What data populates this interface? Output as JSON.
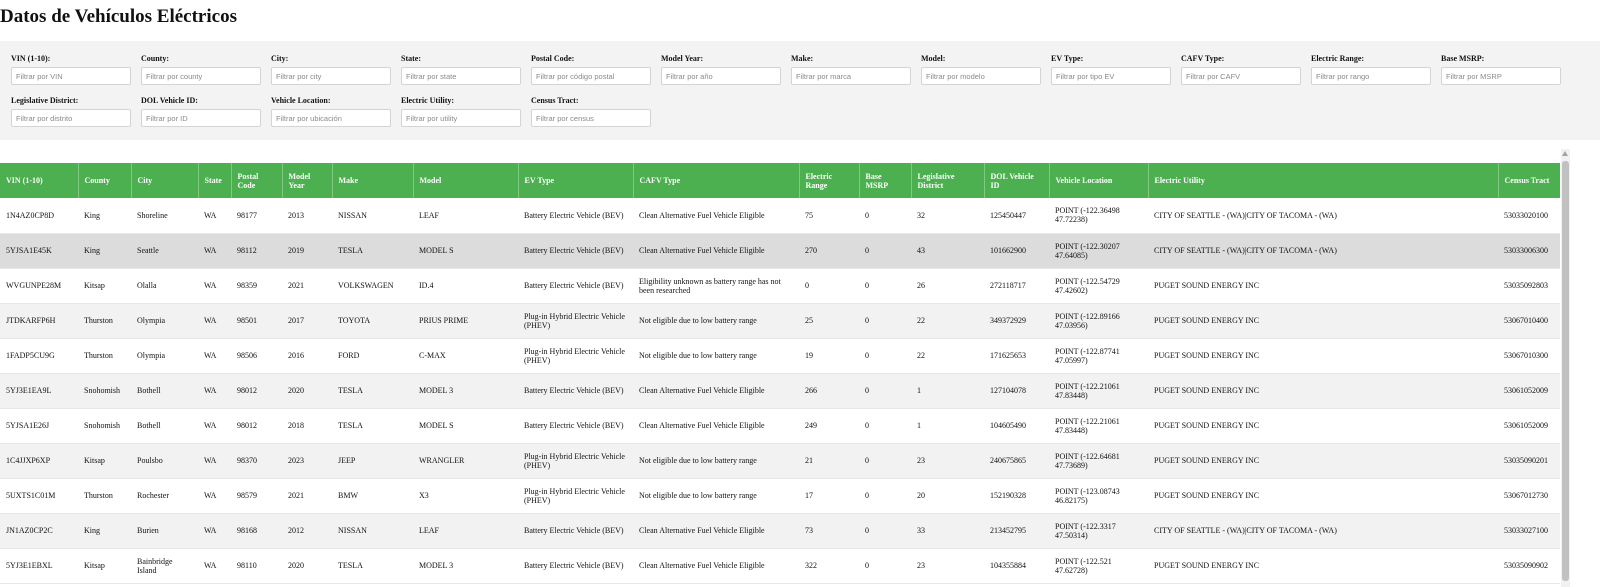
{
  "page": {
    "title": "Datos de Vehículos Eléctricos"
  },
  "filters": [
    {
      "label": "VIN (1-10):",
      "placeholder": "Filtrar por VIN"
    },
    {
      "label": "County:",
      "placeholder": "Filtrar por county"
    },
    {
      "label": "City:",
      "placeholder": "Filtrar por city"
    },
    {
      "label": "State:",
      "placeholder": "Filtrar por state"
    },
    {
      "label": "Postal Code:",
      "placeholder": "Filtrar por código postal"
    },
    {
      "label": "Model Year:",
      "placeholder": "Filtrar por año"
    },
    {
      "label": "Make:",
      "placeholder": "Filtrar por marca"
    },
    {
      "label": "Model:",
      "placeholder": "Filtrar por modelo"
    },
    {
      "label": "EV Type:",
      "placeholder": "Filtrar por tipo EV"
    },
    {
      "label": "CAFV Type:",
      "placeholder": "Filtrar por CAFV"
    },
    {
      "label": "Electric Range:",
      "placeholder": "Filtrar por rango"
    },
    {
      "label": "Base MSRP:",
      "placeholder": "Filtrar por MSRP"
    },
    {
      "label": "Legislative District:",
      "placeholder": "Filtrar por distrito"
    },
    {
      "label": "DOL Vehicle ID:",
      "placeholder": "Filtrar por ID"
    },
    {
      "label": "Vehicle Location:",
      "placeholder": "Filtrar por ubicación"
    },
    {
      "label": "Electric Utility:",
      "placeholder": "Filtrar por utility"
    },
    {
      "label": "Census Tract:",
      "placeholder": "Filtrar por census"
    }
  ],
  "table": {
    "headers": [
      "VIN (1-10)",
      "County",
      "City",
      "State",
      "Postal Code",
      "Model Year",
      "Make",
      "Model",
      "EV Type",
      "CAFV Type",
      "Electric Range",
      "Base MSRP",
      "Legislative District",
      "DOL Vehicle ID",
      "Vehicle Location",
      "Electric Utility",
      "Census Tract"
    ],
    "rows": [
      [
        "1N4AZ0CP8D",
        "King",
        "Shoreline",
        "WA",
        "98177",
        "2013",
        "NISSAN",
        "LEAF",
        "Battery Electric Vehicle (BEV)",
        "Clean Alternative Fuel Vehicle Eligible",
        "75",
        "0",
        "32",
        "125450447",
        "POINT (-122.36498 47.72238)",
        "CITY OF SEATTLE - (WA)|CITY OF TACOMA - (WA)",
        "53033020100"
      ],
      [
        "5YJSA1E45K",
        "King",
        "Seattle",
        "WA",
        "98112",
        "2019",
        "TESLA",
        "MODEL S",
        "Battery Electric Vehicle (BEV)",
        "Clean Alternative Fuel Vehicle Eligible",
        "270",
        "0",
        "43",
        "101662900",
        "POINT (-122.30207 47.64085)",
        "CITY OF SEATTLE - (WA)|CITY OF TACOMA - (WA)",
        "53033006300"
      ],
      [
        "WVGUNPE28M",
        "Kitsap",
        "Olalla",
        "WA",
        "98359",
        "2021",
        "VOLKSWAGEN",
        "ID.4",
        "Battery Electric Vehicle (BEV)",
        "Eligibility unknown as battery range has not been researched",
        "0",
        "0",
        "26",
        "272118717",
        "POINT (-122.54729 47.42602)",
        "PUGET SOUND ENERGY INC",
        "53035092803"
      ],
      [
        "JTDKARFP6H",
        "Thurston",
        "Olympia",
        "WA",
        "98501",
        "2017",
        "TOYOTA",
        "PRIUS PRIME",
        "Plug-in Hybrid Electric Vehicle (PHEV)",
        "Not eligible due to low battery range",
        "25",
        "0",
        "22",
        "349372929",
        "POINT (-122.89166 47.03956)",
        "PUGET SOUND ENERGY INC",
        "53067010400"
      ],
      [
        "1FADP5CU9G",
        "Thurston",
        "Olympia",
        "WA",
        "98506",
        "2016",
        "FORD",
        "C-MAX",
        "Plug-in Hybrid Electric Vehicle (PHEV)",
        "Not eligible due to low battery range",
        "19",
        "0",
        "22",
        "171625653",
        "POINT (-122.87741 47.05997)",
        "PUGET SOUND ENERGY INC",
        "53067010300"
      ],
      [
        "5YJ3E1EA9L",
        "Snohomish",
        "Bothell",
        "WA",
        "98012",
        "2020",
        "TESLA",
        "MODEL 3",
        "Battery Electric Vehicle (BEV)",
        "Clean Alternative Fuel Vehicle Eligible",
        "266",
        "0",
        "1",
        "127104078",
        "POINT (-122.21061 47.83448)",
        "PUGET SOUND ENERGY INC",
        "53061052009"
      ],
      [
        "5YJSA1E26J",
        "Snohomish",
        "Bothell",
        "WA",
        "98012",
        "2018",
        "TESLA",
        "MODEL S",
        "Battery Electric Vehicle (BEV)",
        "Clean Alternative Fuel Vehicle Eligible",
        "249",
        "0",
        "1",
        "104605490",
        "POINT (-122.21061 47.83448)",
        "PUGET SOUND ENERGY INC",
        "53061052009"
      ],
      [
        "1C4JJXP6XP",
        "Kitsap",
        "Poulsbo",
        "WA",
        "98370",
        "2023",
        "JEEP",
        "WRANGLER",
        "Plug-in Hybrid Electric Vehicle (PHEV)",
        "Not eligible due to low battery range",
        "21",
        "0",
        "23",
        "240675865",
        "POINT (-122.64681 47.73689)",
        "PUGET SOUND ENERGY INC",
        "53035090201"
      ],
      [
        "5UXTS1C01M",
        "Thurston",
        "Rochester",
        "WA",
        "98579",
        "2021",
        "BMW",
        "X3",
        "Plug-in Hybrid Electric Vehicle (PHEV)",
        "Not eligible due to low battery range",
        "17",
        "0",
        "20",
        "152190328",
        "POINT (-123.08743 46.82175)",
        "PUGET SOUND ENERGY INC",
        "53067012730"
      ],
      [
        "JN1AZ0CP2C",
        "King",
        "Burien",
        "WA",
        "98168",
        "2012",
        "NISSAN",
        "LEAF",
        "Battery Electric Vehicle (BEV)",
        "Clean Alternative Fuel Vehicle Eligible",
        "73",
        "0",
        "33",
        "213452795",
        "POINT (-122.3317 47.50314)",
        "CITY OF SEATTLE - (WA)|CITY OF TACOMA - (WA)",
        "53033027100"
      ],
      [
        "5YJ3E1EBXL",
        "Kitsap",
        "Bainbridge Island",
        "WA",
        "98110",
        "2020",
        "TESLA",
        "MODEL 3",
        "Battery Electric Vehicle (BEV)",
        "Clean Alternative Fuel Vehicle Eligible",
        "322",
        "0",
        "23",
        "104355884",
        "POINT (-122.521 47.62728)",
        "PUGET SOUND ENERGY INC",
        "53035090902"
      ]
    ]
  }
}
